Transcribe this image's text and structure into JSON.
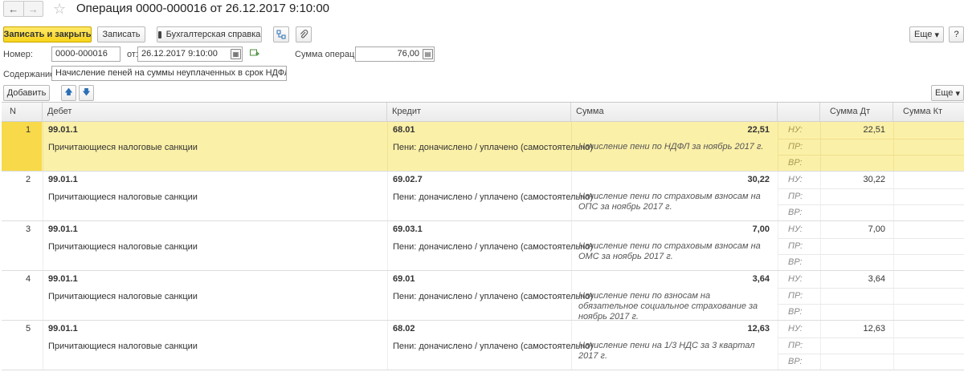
{
  "window": {
    "title": "Операция 0000-000016 от 26.12.2017 9:10:00",
    "back_glyph": "←",
    "forward_glyph": "→",
    "star_glyph": "☆"
  },
  "toolbar": {
    "save_close_label": "Записать и закрыть",
    "save_label": "Записать",
    "report_label": "Бухгалтерская справка",
    "more_label": "Еще",
    "help_label": "?",
    "dropdown_glyph": "▾"
  },
  "form": {
    "number_label": "Номер:",
    "number_value": "0000-000016",
    "date_label": "от:",
    "date_value": "26.12.2017  9:10:00",
    "sum_label": "Сумма операции:",
    "sum_value": "76,00",
    "content_label": "Содержание:",
    "content_value": "Начисление пеней на суммы неуплаченных в срок НДФЛ и страхо"
  },
  "table_toolbar": {
    "add_label": "Добавить",
    "more_label": "Еще",
    "up_glyph": "🡅",
    "down_glyph": "🡇"
  },
  "table": {
    "columns": {
      "n": "N",
      "debit": "Дебет",
      "credit": "Кредит",
      "sum": "Сумма",
      "sum_dt": "Сумма Дт",
      "sum_kt": "Сумма Кт"
    },
    "labels": {
      "nu": "НУ:",
      "pr": "ПР:",
      "vr": "ВР:"
    },
    "rows": [
      {
        "n": "1",
        "debit": "99.01.1",
        "debit_sub": "Причитающиеся налоговые санкции",
        "credit": "68.01",
        "credit_sub": "Пени: доначислено / уплачено (самостоятельно)",
        "sum": "22,51",
        "content": "Начисление пени по НДФЛ за ноябрь 2017 г.",
        "sum_dt": "22,51"
      },
      {
        "n": "2",
        "debit": "99.01.1",
        "debit_sub": "Причитающиеся налоговые санкции",
        "credit": "69.02.7",
        "credit_sub": "Пени: доначислено / уплачено (самостоятельно)",
        "sum": "30,22",
        "content": "Начисление пени по страховым взносам на ОПС за ноябрь 2017 г.",
        "sum_dt": "30,22"
      },
      {
        "n": "3",
        "debit": "99.01.1",
        "debit_sub": "Причитающиеся налоговые санкции",
        "credit": "69.03.1",
        "credit_sub": "Пени: доначислено / уплачено (самостоятельно)",
        "sum": "7,00",
        "content": "Начисление пени по страховым взносам на ОМС за ноябрь 2017 г.",
        "sum_dt": "7,00"
      },
      {
        "n": "4",
        "debit": "99.01.1",
        "debit_sub": "Причитающиеся налоговые санкции",
        "credit": "69.01",
        "credit_sub": "Пени: доначислено / уплачено (самостоятельно)",
        "sum": "3,64",
        "content": "Начисление пени по взносам на обязательное социальное страхование за ноябрь 2017 г.",
        "sum_dt": "3,64"
      },
      {
        "n": "5",
        "debit": "99.01.1",
        "debit_sub": "Причитающиеся налоговые санкции",
        "credit": "68.02",
        "credit_sub": "Пени: доначислено / уплачено (самостоятельно)",
        "sum": "12,63",
        "content": "Начисление пени на 1/3 НДС за 3 квартал 2017 г.",
        "sum_dt": "12,63"
      }
    ]
  }
}
